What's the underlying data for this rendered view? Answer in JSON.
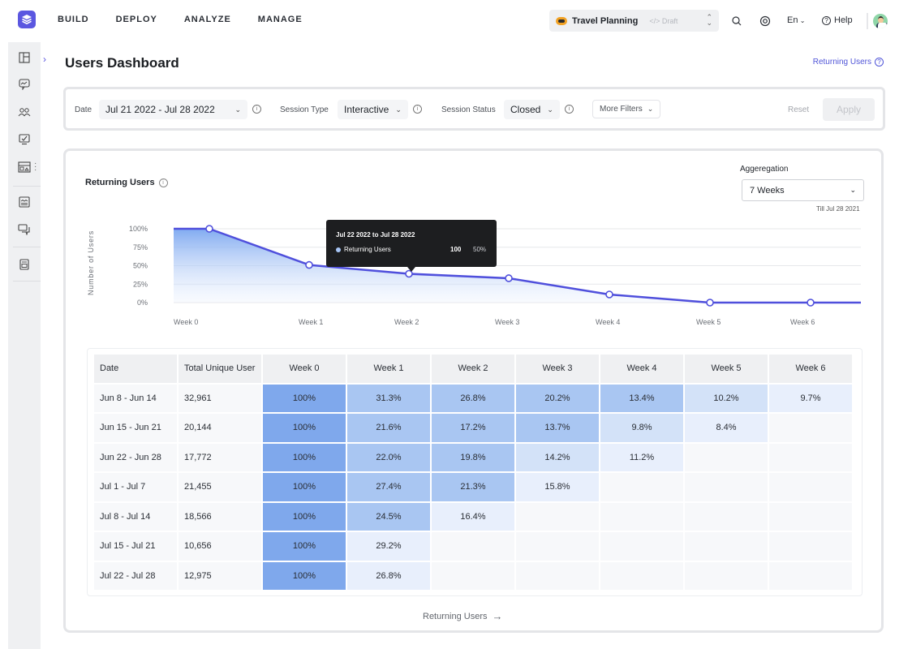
{
  "topnav": {
    "items": [
      "BUILD",
      "DEPLOY",
      "ANALYZE",
      "MANAGE"
    ]
  },
  "project": {
    "name": "Travel Planning",
    "status": "Draft",
    "icon": "bot-icon"
  },
  "header_tools": {
    "language": "En",
    "help_label": "Help"
  },
  "sidebar": {
    "items": [
      {
        "icon": "layout-icon"
      },
      {
        "icon": "chat-analytics-icon"
      },
      {
        "icon": "users-icon"
      },
      {
        "icon": "monitor-check-icon"
      },
      {
        "icon": "dashboard-card-icon"
      },
      {
        "icon": "report-icon"
      },
      {
        "icon": "conversations-icon"
      },
      {
        "icon": "document-icon"
      }
    ]
  },
  "page": {
    "title": "Users Dashboard",
    "help_link": "Returning Users"
  },
  "filters": {
    "date_label": "Date",
    "date_value": "Jul 21 2022 - Jul 28 2022",
    "session_type_label": "Session Type",
    "session_type_value": "Interactive",
    "session_status_label": "Session Status",
    "session_status_value": "Closed",
    "more_filters": "More Filters",
    "reset": "Reset",
    "apply": "Apply"
  },
  "card": {
    "title": "Returning Users",
    "aggregation_label": "Aggeregation",
    "aggregation_value": "7 Weeks",
    "till_label": "Till Jul 28 2021",
    "footer_link": "Returning Users"
  },
  "tooltip": {
    "date_range": "Jul 22 2022 to Jul 28 2022",
    "series": "Returning Users",
    "value": "100",
    "percent": "50%"
  },
  "chart_data": {
    "type": "area",
    "title": "Returning Users",
    "xlabel": "",
    "ylabel": "Number of Users",
    "categories": [
      "Week 0",
      "Week 1",
      "Week 2",
      "Week 3",
      "Week 4",
      "Week 5",
      "Week 6"
    ],
    "series": [
      {
        "name": "Returning Users",
        "values": [
          100,
          51,
          39,
          33,
          11,
          0,
          0
        ],
        "color": "#4f4fdc"
      }
    ],
    "yticks": [
      "0%",
      "25%",
      "50%",
      "75%",
      "100%"
    ],
    "ylim": [
      0,
      100
    ],
    "grid": true,
    "legend": "none"
  },
  "table": {
    "headers": [
      "Date",
      "Total Unique User",
      "Week 0",
      "Week 1",
      "Week 2",
      "Week 3",
      "Week 4",
      "Week 5",
      "Week 6"
    ],
    "rows": [
      {
        "date": "Jun 8  - Jun 14",
        "total": "32,961",
        "weeks": [
          "100%",
          "31.3%",
          "26.8%",
          "20.2%",
          "13.4%",
          "10.2%",
          "9.7%"
        ],
        "levels": [
          1,
          2,
          2,
          2,
          2,
          3,
          4
        ]
      },
      {
        "date": "Jun 15 - Jun 21",
        "total": "20,144",
        "weeks": [
          "100%",
          "21.6%",
          "17.2%",
          "13.7%",
          "9.8%",
          "8.4%",
          ""
        ],
        "levels": [
          1,
          2,
          2,
          2,
          3,
          4,
          0
        ]
      },
      {
        "date": "Jun 22 - Jun 28",
        "total": "17,772",
        "weeks": [
          "100%",
          "22.0%",
          "19.8%",
          "14.2%",
          "11.2%",
          "",
          ""
        ],
        "levels": [
          1,
          2,
          2,
          3,
          4,
          0,
          0
        ]
      },
      {
        "date": "Jul 1  - Jul 7",
        "total": "21,455",
        "weeks": [
          "100%",
          "27.4%",
          "21.3%",
          "15.8%",
          "",
          "",
          ""
        ],
        "levels": [
          1,
          2,
          2,
          4,
          0,
          0,
          0
        ]
      },
      {
        "date": "Jul 8 - Jul 14",
        "total": "18,566",
        "weeks": [
          "100%",
          "24.5%",
          "16.4%",
          "",
          "",
          "",
          ""
        ],
        "levels": [
          1,
          2,
          4,
          0,
          0,
          0,
          0
        ]
      },
      {
        "date": "Jul 15 - Jul 21",
        "total": "10,656",
        "weeks": [
          "100%",
          "29.2%",
          "",
          "",
          "",
          "",
          ""
        ],
        "levels": [
          1,
          4,
          0,
          0,
          0,
          0,
          0
        ]
      },
      {
        "date": "Jul 22  - Jul 28",
        "total": "12,975",
        "weeks": [
          "100%",
          "26.8%",
          "",
          "",
          "",
          "",
          ""
        ],
        "levels": [
          1,
          4,
          0,
          0,
          0,
          0,
          0
        ]
      }
    ]
  }
}
